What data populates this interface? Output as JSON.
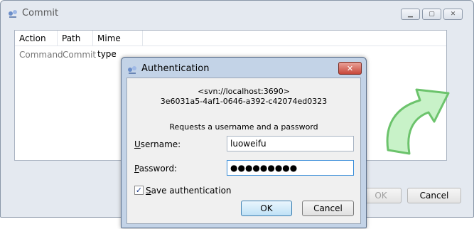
{
  "commit_window": {
    "title": "Commit",
    "columns": [
      "Action",
      "Path",
      "Mime type"
    ],
    "rows": [
      {
        "action": "Command",
        "path": "Commit",
        "mime": ""
      }
    ],
    "ok_label": "OK",
    "cancel_label": "Cancel"
  },
  "auth_dialog": {
    "title": "Authentication",
    "realm_line1": "<svn://localhost:3690>",
    "realm_line2": "3e6031a5-4af1-0646-a392-c42074ed0323",
    "request_text": "Requests a username and a password",
    "username_label_u": "U",
    "username_label_rest": "sername:",
    "username_value": "luoweifu",
    "password_label_u": "P",
    "password_label_rest": "assword:",
    "password_value": "●●●●●●●●●",
    "save_auth_u": "S",
    "save_auth_rest": "ave authentication",
    "save_auth_checked": "✓",
    "ok_label": "OK",
    "cancel_label": "Cancel",
    "close_glyph": "✕"
  },
  "colors": {
    "accent_arrow": "#9be29b"
  }
}
